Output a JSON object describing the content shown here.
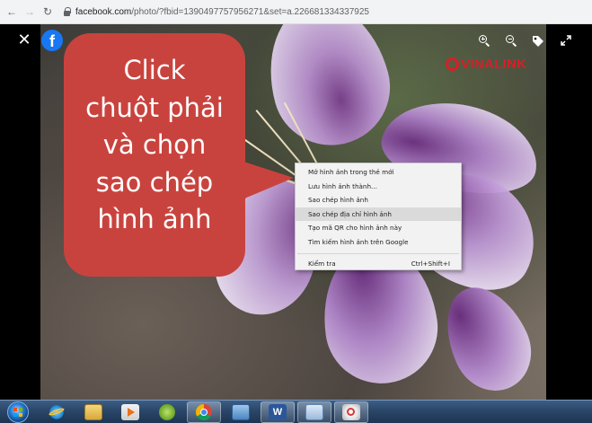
{
  "browser": {
    "back_icon": "arrow-left-icon",
    "forward_icon": "arrow-right-icon",
    "reload_icon": "reload-icon",
    "lock_icon": "lock-icon",
    "url_host": "facebook.com",
    "url_path": "/photo/?fbid=1390497757956271&set=a.226681334337925"
  },
  "viewer": {
    "close_icon": "close-icon",
    "logo_icon": "facebook-logo-icon",
    "logo_letter": "f",
    "controls": [
      "zoom-in-icon",
      "zoom-out-icon",
      "tag-icon",
      "fullscreen-icon"
    ],
    "watermark": "VINALINK",
    "watermark_color": "#d71f26"
  },
  "callout": {
    "lines": [
      "Click",
      "chuột phải",
      "và chọn",
      "sao chép",
      "hình ảnh"
    ],
    "color": "#c9433e"
  },
  "context_menu": {
    "items": [
      {
        "label": "Mở hình ảnh trong thẻ mới",
        "shortcut": ""
      },
      {
        "label": "Lưu hình ảnh thành...",
        "shortcut": ""
      },
      {
        "label": "Sao chép hình ảnh",
        "shortcut": ""
      },
      {
        "label": "Sao chép địa chỉ hình ảnh",
        "shortcut": "",
        "highlighted": true
      },
      {
        "label": "Tạo mã QR cho hình ảnh này",
        "shortcut": ""
      },
      {
        "label": "Tìm kiếm hình ảnh trên Google",
        "shortcut": ""
      }
    ],
    "inspect": {
      "label": "Kiểm tra",
      "shortcut": "Ctrl+Shift+I"
    }
  },
  "taskbar": {
    "start_icon": "windows-start-icon",
    "apps": [
      {
        "icon": "internet-explorer-icon",
        "active": false
      },
      {
        "icon": "file-explorer-icon",
        "active": false
      },
      {
        "icon": "media-player-icon",
        "active": false
      },
      {
        "icon": "unikey-icon",
        "active": false
      },
      {
        "icon": "chrome-icon",
        "active": true
      },
      {
        "icon": "remote-desktop-icon",
        "active": false
      },
      {
        "icon": "word-icon",
        "active": true
      },
      {
        "icon": "window-icon",
        "active": true
      },
      {
        "icon": "snipping-tool-icon",
        "active": true
      }
    ]
  }
}
